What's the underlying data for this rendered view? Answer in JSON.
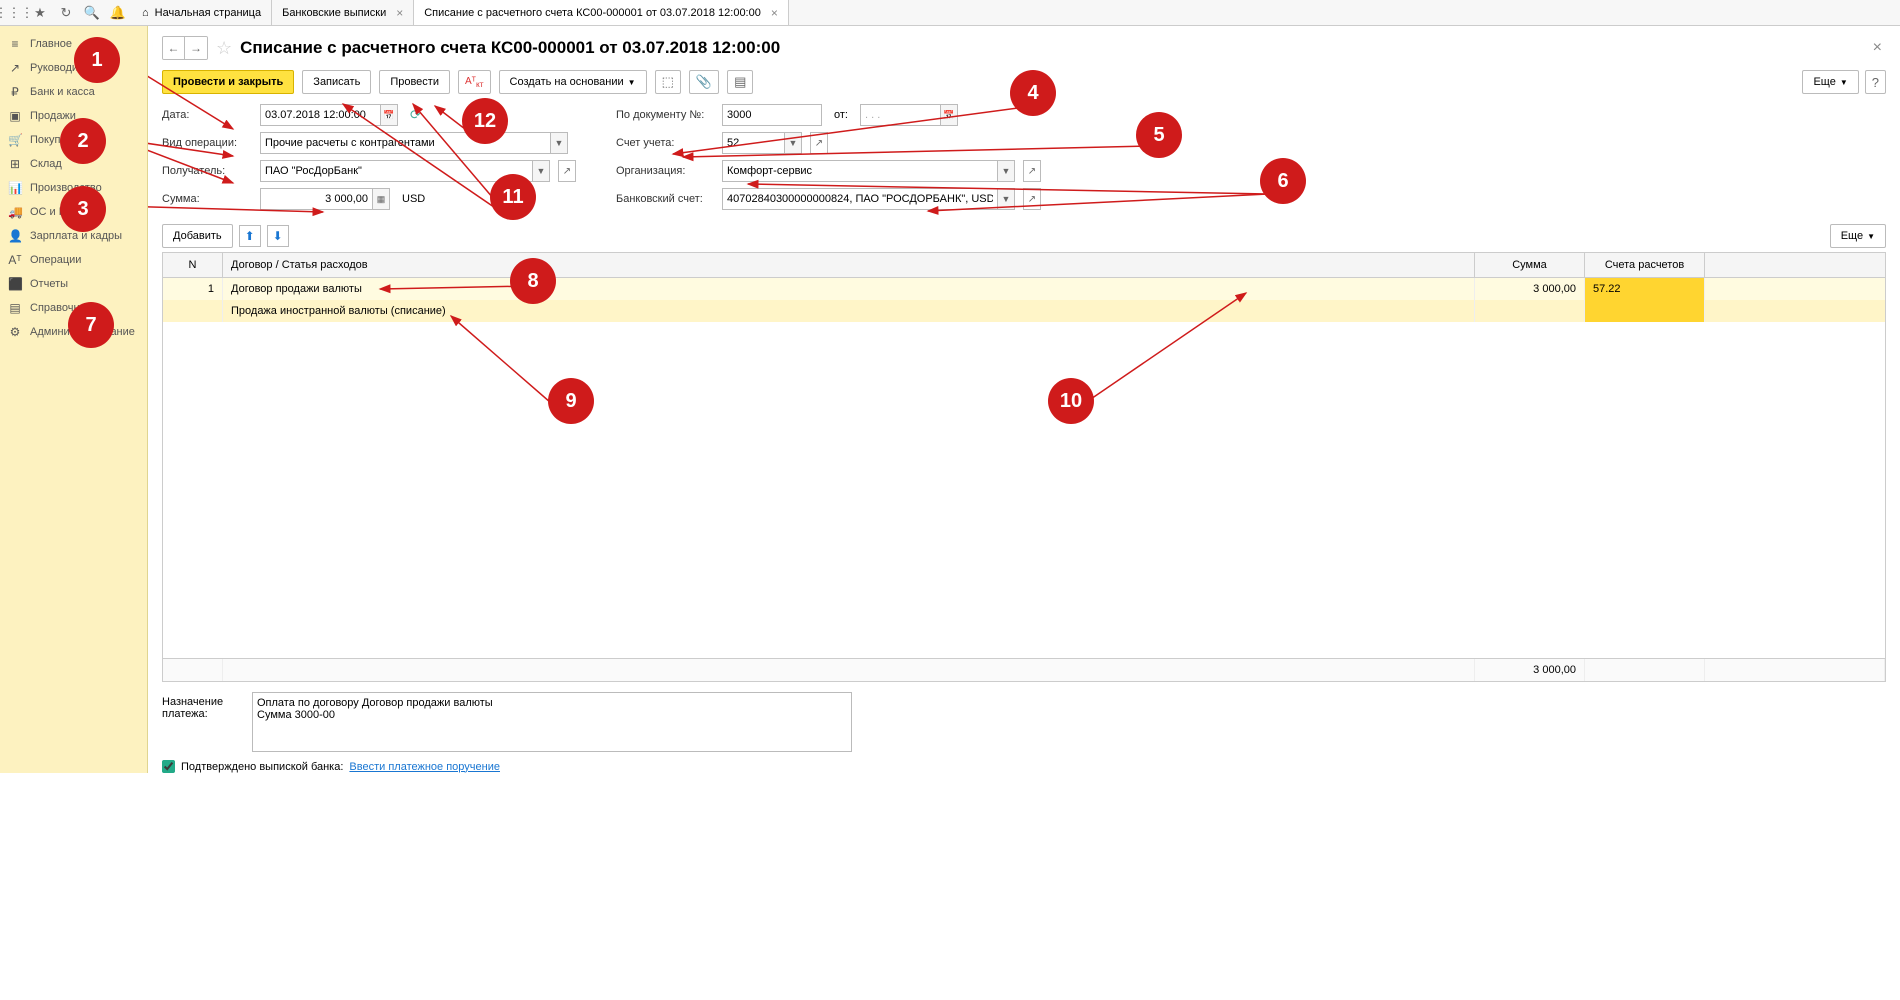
{
  "topIcons": [
    "apps",
    "star",
    "clipboard",
    "search",
    "bell"
  ],
  "tabs": [
    {
      "icon": "⌂",
      "label": "Начальная страница",
      "closable": false
    },
    {
      "label": "Банковские выписки",
      "closable": true
    },
    {
      "label": "Списание с расчетного счета КС00-000001 от 03.07.2018 12:00:00",
      "closable": true,
      "active": true
    }
  ],
  "sidebar": [
    {
      "icon": "≡",
      "label": "Главное"
    },
    {
      "icon": "↗",
      "label": "Руководителю"
    },
    {
      "icon": "₽",
      "label": "Банк и касса"
    },
    {
      "icon": "▣",
      "label": "Продажи"
    },
    {
      "icon": "🛒",
      "label": "Покупки"
    },
    {
      "icon": "⊞",
      "label": "Склад"
    },
    {
      "icon": "📊",
      "label": "Производство"
    },
    {
      "icon": "🚚",
      "label": "ОС и НМА"
    },
    {
      "icon": "👤",
      "label": "Зарплата и кадры"
    },
    {
      "icon": "Aᵀ",
      "label": "Операции"
    },
    {
      "icon": "⬛",
      "label": "Отчеты"
    },
    {
      "icon": "▤",
      "label": "Справочники"
    },
    {
      "icon": "⚙",
      "label": "Администрирование"
    }
  ],
  "title": "Списание с расчетного счета КС00-000001 от 03.07.2018 12:00:00",
  "actions": {
    "postClose": "Провести и закрыть",
    "save": "Записать",
    "post": "Провести",
    "createBased": "Создать на основании",
    "more": "Еще"
  },
  "form": {
    "dateLabel": "Дата:",
    "date": "03.07.2018 12:00:00",
    "opTypeLabel": "Вид операции:",
    "opType": "Прочие расчеты с контрагентами",
    "payeeLabel": "Получатель:",
    "payee": "ПАО \"РосДорБанк\"",
    "sumLabel": "Сумма:",
    "sum": "3 000,00",
    "currency": "USD",
    "docNumLabel": "По документу №:",
    "docNum": "3000",
    "fromLabel": "от:",
    "fromDate": ". . .",
    "accountLabel": "Счет учета:",
    "account": "52",
    "orgLabel": "Организация:",
    "org": "Комфорт-сервис",
    "bankAccLabel": "Банковский счет:",
    "bankAcc": "40702840300000000824, ПАО \"РОСДОРБАНК\", USD"
  },
  "tableActions": {
    "add": "Добавить",
    "more": "Еще"
  },
  "tableHead": {
    "n": "N",
    "d": "Договор / Статья расходов",
    "s": "Сумма",
    "a": "Счета расчетов"
  },
  "tableRow": {
    "n": "1",
    "contract": "Договор продажи валюты",
    "expense": "Продажа иностранной валюты (списание)",
    "sum": "3 000,00",
    "acc": "57.22"
  },
  "tableTotal": "3 000,00",
  "purposeLabel": "Назначение платежа:",
  "purpose": "Оплата по договору Договор продажи валюты\nСумма 3000-00",
  "confirmLabel": "Подтверждено выпиской банка:",
  "confirmLink": "Ввести платежное поручение",
  "callouts": [
    "1",
    "2",
    "3",
    "4",
    "5",
    "6",
    "7",
    "8",
    "9",
    "10",
    "11",
    "12"
  ]
}
